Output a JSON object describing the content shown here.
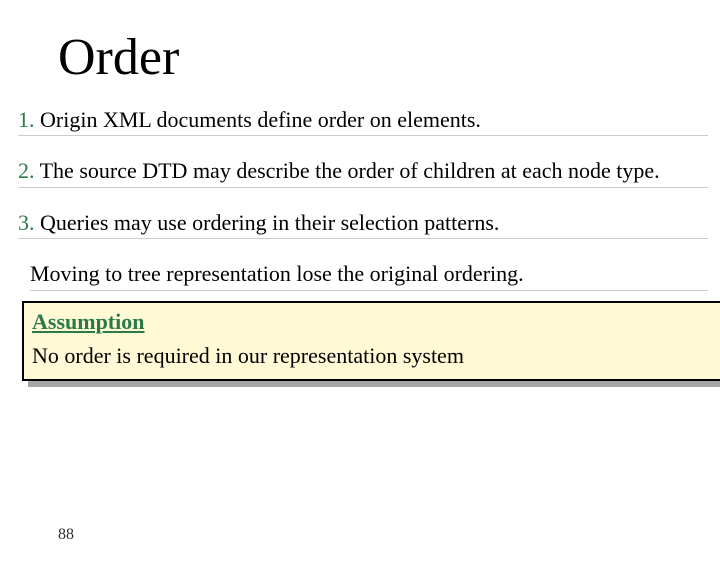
{
  "title": "Order",
  "items": [
    {
      "num": "1.",
      "text": "Origin XML documents define order on elements."
    },
    {
      "num": "2.",
      "text": "The source DTD may describe the order of children at each node type."
    },
    {
      "num": "3.",
      "text": "Queries may use ordering in their selection patterns."
    }
  ],
  "note": "Moving to tree representation lose the original ordering.",
  "box": {
    "label": "Assumption",
    "text": "No order is required in our representation system"
  },
  "page_number": "88"
}
